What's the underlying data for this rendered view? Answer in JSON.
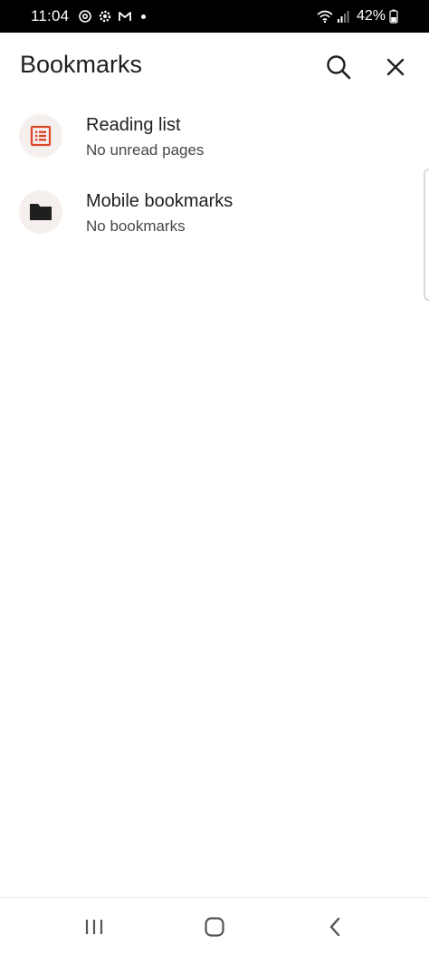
{
  "status_bar": {
    "time": "11:04",
    "battery": "42%"
  },
  "header": {
    "title": "Bookmarks"
  },
  "items": [
    {
      "title": "Reading list",
      "subtitle": "No unread pages",
      "icon": "reading-list-icon"
    },
    {
      "title": "Mobile bookmarks",
      "subtitle": "No bookmarks",
      "icon": "folder-icon"
    }
  ],
  "colors": {
    "accent": "#d9482b",
    "icon_bg": "#f5efed",
    "text_primary": "#1f1f1f",
    "text_secondary": "#474747"
  }
}
